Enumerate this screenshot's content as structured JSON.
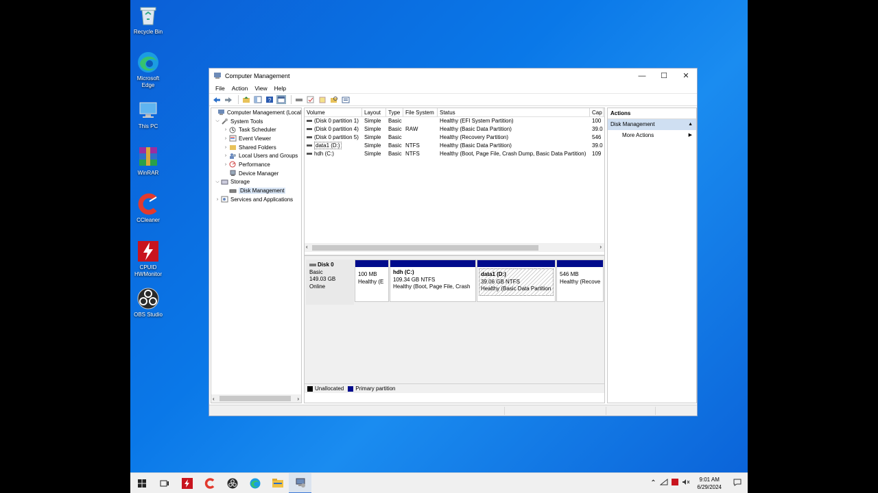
{
  "desktop": {
    "icons": [
      {
        "label": "Recycle Bin",
        "icon": "recycle-bin-icon"
      },
      {
        "label": "Microsoft Edge",
        "icon": "edge-icon"
      },
      {
        "label": "This PC",
        "icon": "pc-icon"
      },
      {
        "label": "WinRAR",
        "icon": "winrar-icon"
      },
      {
        "label": "CCleaner",
        "icon": "ccleaner-icon"
      },
      {
        "label": "CPUID HWMonitor",
        "icon": "hwmonitor-icon"
      },
      {
        "label": "OBS Studio",
        "icon": "obs-icon"
      }
    ]
  },
  "window": {
    "title": "Computer Management",
    "controls": {
      "minimize": "—",
      "maximize": "☐",
      "close": "✕"
    }
  },
  "menu": {
    "file": "File",
    "action": "Action",
    "view": "View",
    "help": "Help"
  },
  "tree": {
    "root": "Computer Management (Local",
    "system_tools": "System Tools",
    "task_scheduler": "Task Scheduler",
    "event_viewer": "Event Viewer",
    "shared_folders": "Shared Folders",
    "local_users": "Local Users and Groups",
    "performance": "Performance",
    "device_manager": "Device Manager",
    "storage": "Storage",
    "disk_management": "Disk Management",
    "services_apps": "Services and Applications"
  },
  "volumes": {
    "headers": [
      "Volume",
      "Layout",
      "Type",
      "File System",
      "Status",
      "Cap"
    ],
    "rows": [
      {
        "volume": "(Disk 0 partition 1)",
        "layout": "Simple",
        "type": "Basic",
        "fs": "",
        "status": "Healthy (EFI System Partition)",
        "cap": "100"
      },
      {
        "volume": "(Disk 0 partition 4)",
        "layout": "Simple",
        "type": "Basic",
        "fs": "RAW",
        "status": "Healthy (Basic Data Partition)",
        "cap": "39.0"
      },
      {
        "volume": "(Disk 0 partition 5)",
        "layout": "Simple",
        "type": "Basic",
        "fs": "",
        "status": "Healthy (Recovery Partition)",
        "cap": "546"
      },
      {
        "volume": "data1 (D:)",
        "layout": "Simple",
        "type": "Basic",
        "fs": "NTFS",
        "status": "Healthy (Basic Data Partition)",
        "cap": "39.0"
      },
      {
        "volume": "hdh (C:)",
        "layout": "Simple",
        "type": "Basic",
        "fs": "NTFS",
        "status": "Healthy (Boot, Page File, Crash Dump, Basic Data Partition)",
        "cap": "109"
      }
    ]
  },
  "disk": {
    "name": "Disk 0",
    "type": "Basic",
    "size": "149.03 GB",
    "state": "Online",
    "partitions": [
      {
        "name": "",
        "size": "100 MB",
        "status": "Healthy (E"
      },
      {
        "name": "hdh  (C:)",
        "size": "109.34 GB NTFS",
        "status": "Healthy (Boot, Page File, Crash"
      },
      {
        "name": "data1  (D:)",
        "size": "39.06 GB NTFS",
        "status": "Healthy (Basic Data Partition"
      },
      {
        "name": "",
        "size": "546 MB",
        "status": "Healthy (Recove"
      }
    ]
  },
  "legend": {
    "unallocated": "Unallocated",
    "primary": "Primary partition",
    "unallocated_color": "#000000",
    "primary_color": "#000b8c"
  },
  "actions": {
    "title": "Actions",
    "selected": "Disk Management",
    "more": "More Actions"
  },
  "taskbar": {
    "time": "9:01 AM",
    "date": "6/29/2024"
  }
}
